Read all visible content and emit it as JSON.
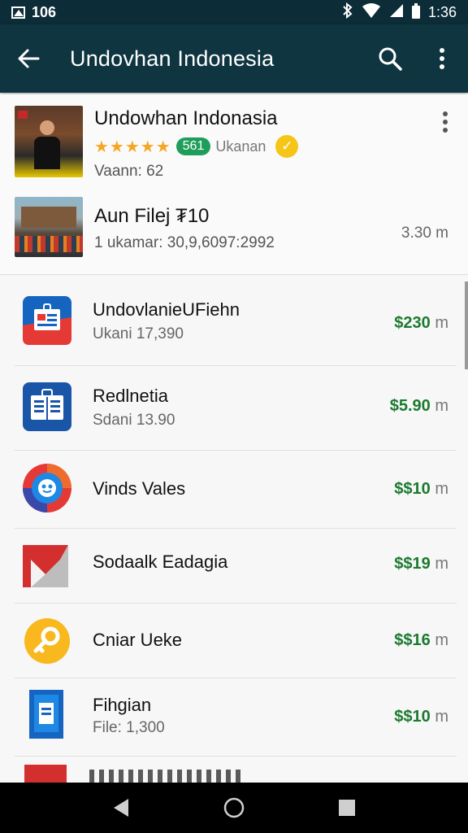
{
  "status_bar": {
    "time_left": "106",
    "time_right": "1:36"
  },
  "app_bar": {
    "title": "Undovhan Indonesia"
  },
  "header": {
    "title": "Undowhan Indonasia",
    "rating_stars": "★★★★★",
    "score_badge": "561",
    "rating_label": "Ukanan",
    "verified_mark": "✓",
    "subtitle": "Vaann: 62",
    "row2_title": "Aun Filej ₮10",
    "row2_subtitle": "1 ukamar: 30,9,6097:2992",
    "row2_meta": "3.30 m"
  },
  "items": [
    {
      "title": "UndovlanieUFiehn",
      "subtitle": "Ukani 17,390",
      "price": "$230",
      "unit": "m",
      "icon": "document-icon"
    },
    {
      "title": "Redlnetia",
      "subtitle": "Sdani 13.90",
      "price": "$5.90",
      "unit": "m",
      "icon": "reader-icon"
    },
    {
      "title": "Vinds Vales",
      "subtitle": "",
      "price": "$$10",
      "unit": "m",
      "icon": "globe-icon"
    },
    {
      "title": "Sodaalk Eadagia",
      "subtitle": "",
      "price": "$$19",
      "unit": "m",
      "icon": "mail-icon"
    },
    {
      "title": "Cniar Ueke",
      "subtitle": "",
      "price": "$$16",
      "unit": "m",
      "icon": "key-icon"
    },
    {
      "title": "Fihgian",
      "subtitle": "File: 1,300",
      "price": "$$10",
      "unit": "m",
      "icon": "file-icon"
    }
  ],
  "colors": {
    "status_bar_bg": "#0c2c38",
    "app_bar_bg": "#0f3540",
    "price_green": "#1b7a2f",
    "star_gold": "#f5a623",
    "badge_green": "#1e9e5a"
  }
}
